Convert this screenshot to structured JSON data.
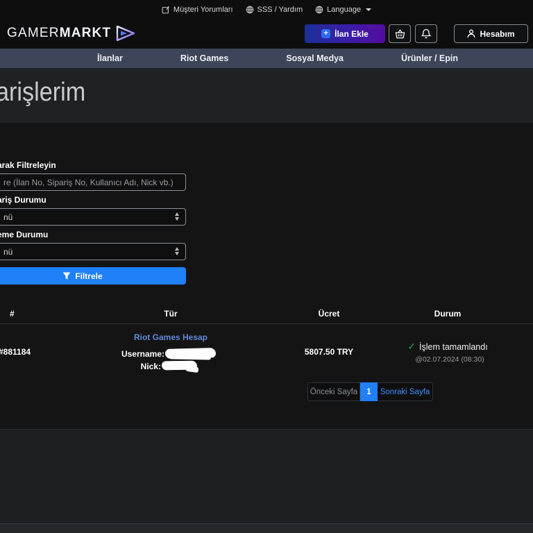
{
  "topbar": {
    "customer_reviews": "Müşteri Yorumları",
    "faq": "SSS / Yardım",
    "language": "Language"
  },
  "header": {
    "logo_part1": "GAMER",
    "logo_part2": "MARKT",
    "add_listing": "İlan Ekle",
    "account": "Hesabım"
  },
  "nav": {
    "items": [
      {
        "label": "İlanlar"
      },
      {
        "label": "Riot Games"
      },
      {
        "label": "Sosyal Medya"
      },
      {
        "label": "Ürünler / Epin"
      }
    ]
  },
  "page": {
    "title": "arişlerim"
  },
  "filters": {
    "search_label": "arak Filtreleyin",
    "search_placeholder": "re (İlan No, Sipariş No, Kullanıcı Adı, Nick vb.)",
    "order_status_label": "ariş Durumu",
    "order_status_value": "nü",
    "payment_status_label": "eme Durumu",
    "payment_status_value": "nü",
    "filter_button": "Filtrele"
  },
  "orders_table": {
    "headers": {
      "id": "#",
      "type": "Tür",
      "price": "Ücret",
      "status": "Durum"
    },
    "rows": [
      {
        "id": "#881184",
        "type_link": "Riot Games Hesap",
        "username_label": "Username:",
        "nick_label": "Nick:",
        "price": "5807.50 TRY",
        "status": "İşlem tamamlandı",
        "status_time": "@02.07.2024 (08:30)",
        "check": "✓"
      }
    ]
  },
  "pagination": {
    "prev": "Önceki Sayfa",
    "current": "1",
    "next": "Sonraki Sayfa"
  },
  "colors": {
    "accent_blue": "#1f80f8",
    "nav_bg": "#3d4658",
    "success_green": "#28a745",
    "link_blue": "#6188d8",
    "add_button_gradient_start": "#1c2f96",
    "add_button_gradient_end": "#520d9c"
  }
}
